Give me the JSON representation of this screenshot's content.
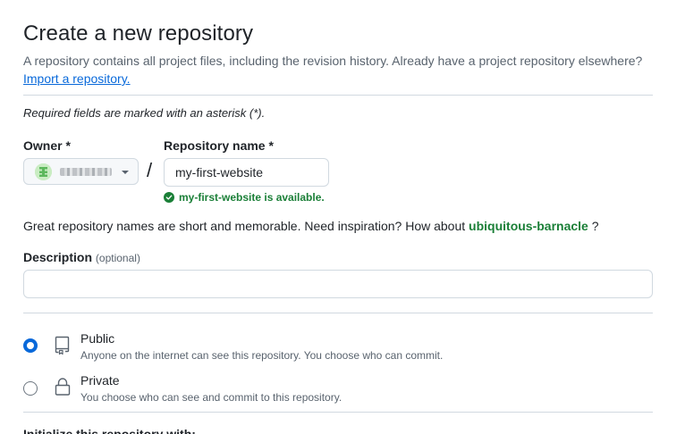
{
  "header": {
    "title": "Create a new repository",
    "subtitle": "A repository contains all project files, including the revision history. Already have a project repository elsewhere?",
    "import_link": "Import a repository."
  },
  "form": {
    "required_note": "Required fields are marked with an asterisk (*).",
    "owner": {
      "label": "Owner *",
      "avatar_icon": "identicon-avatar",
      "name_redacted": true
    },
    "separator": "/",
    "repo_name": {
      "label": "Repository name *",
      "value": "my-first-website",
      "availability": "my-first-website is available.",
      "availability_color": "#1a7f37"
    },
    "inspiration": {
      "prefix": "Great repository names are short and memorable. Need inspiration? How about",
      "suggestion": "ubiquitous-barnacle",
      "suffix": "?"
    },
    "description": {
      "label": "Description",
      "optional": "(optional)",
      "value": "",
      "placeholder": ""
    },
    "visibility": [
      {
        "id": "public",
        "label": "Public",
        "description": "Anyone on the internet can see this repository. You choose who can commit.",
        "icon": "repo-icon",
        "checked": true
      },
      {
        "id": "private",
        "label": "Private",
        "description": "You choose who can see and commit to this repository.",
        "icon": "lock-icon",
        "checked": false
      }
    ],
    "next_section_heading": "Initialize this repository with:"
  },
  "colors": {
    "accent": "#0969da",
    "success": "#1a7f37",
    "border": "#d1d9e0",
    "muted_text": "#59636e"
  }
}
